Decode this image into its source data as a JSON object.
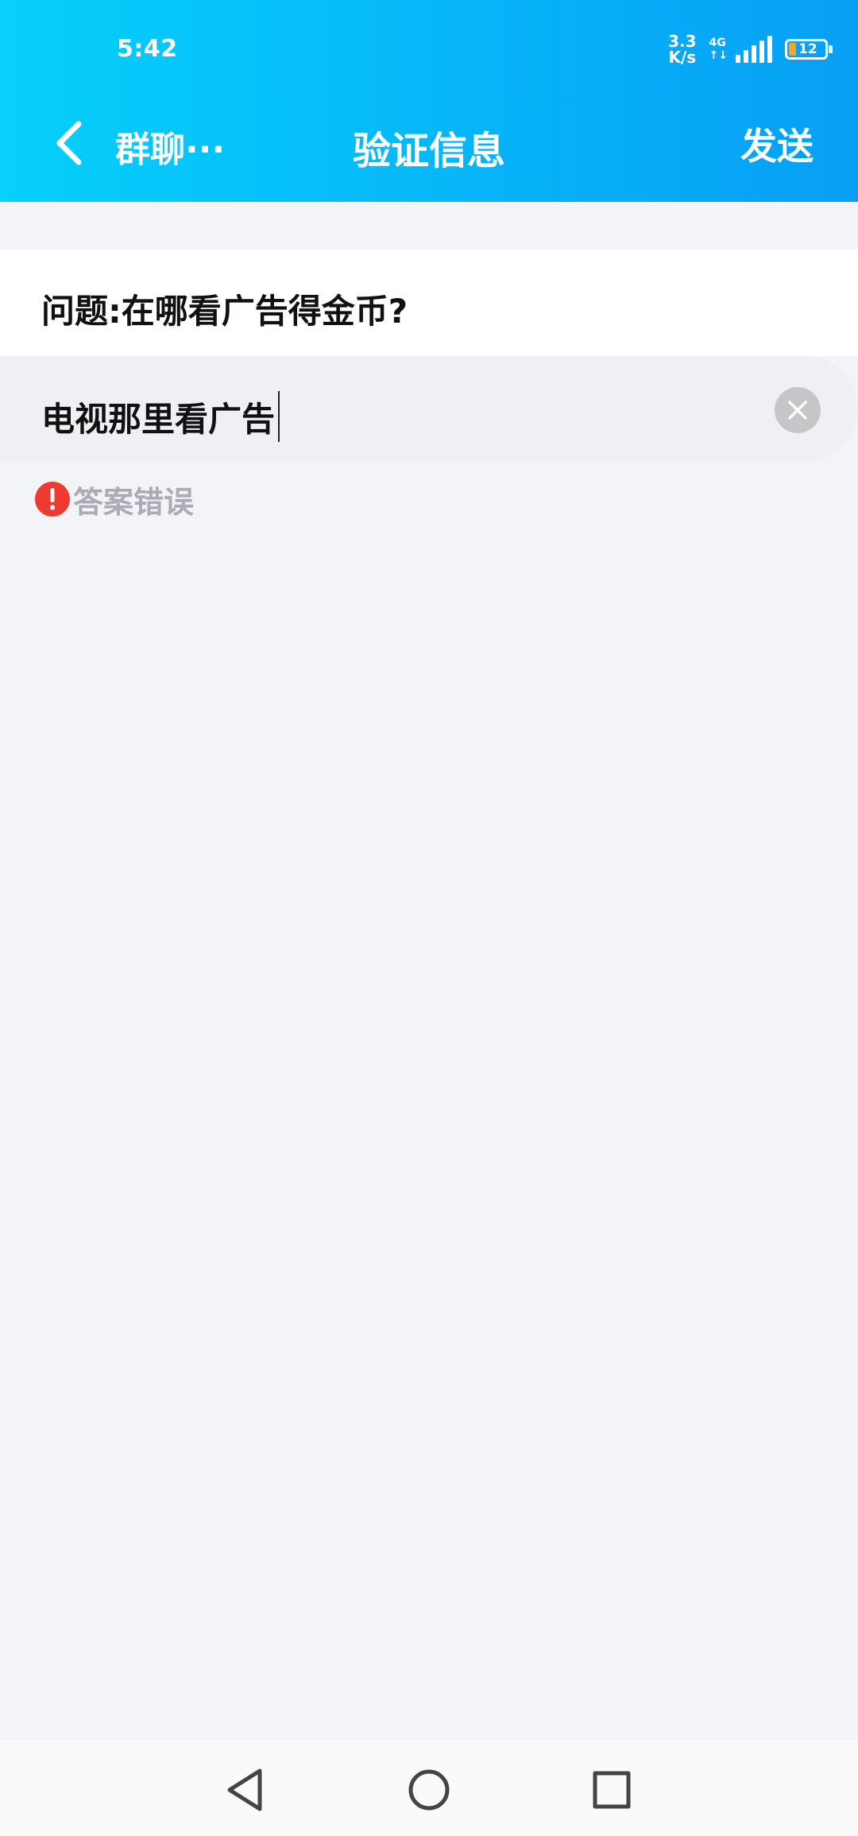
{
  "status_bar": {
    "time": "5:42",
    "net_speed_value": "3.3",
    "net_speed_unit": "K/s",
    "net_type": "4G",
    "net_arrows": "↑↓",
    "battery_level": "12",
    "battery_fill": 0.12,
    "battery_fill_color": "#f5a623"
  },
  "header": {
    "back_label": "群聊···",
    "title": "验证信息",
    "send_label": "发送",
    "gradient_start": "#06d0fb",
    "gradient_end": "#079ff5"
  },
  "question": {
    "text": "问题:在哪看广告得金币?"
  },
  "answer": {
    "value": "电视那里看广告"
  },
  "error": {
    "text": "答案错误",
    "icon": "exclamation-icon",
    "color": "#ee3b32"
  },
  "nav_bar": {
    "icons": [
      "back-triangle-icon",
      "home-circle-icon",
      "recents-square-icon"
    ]
  }
}
